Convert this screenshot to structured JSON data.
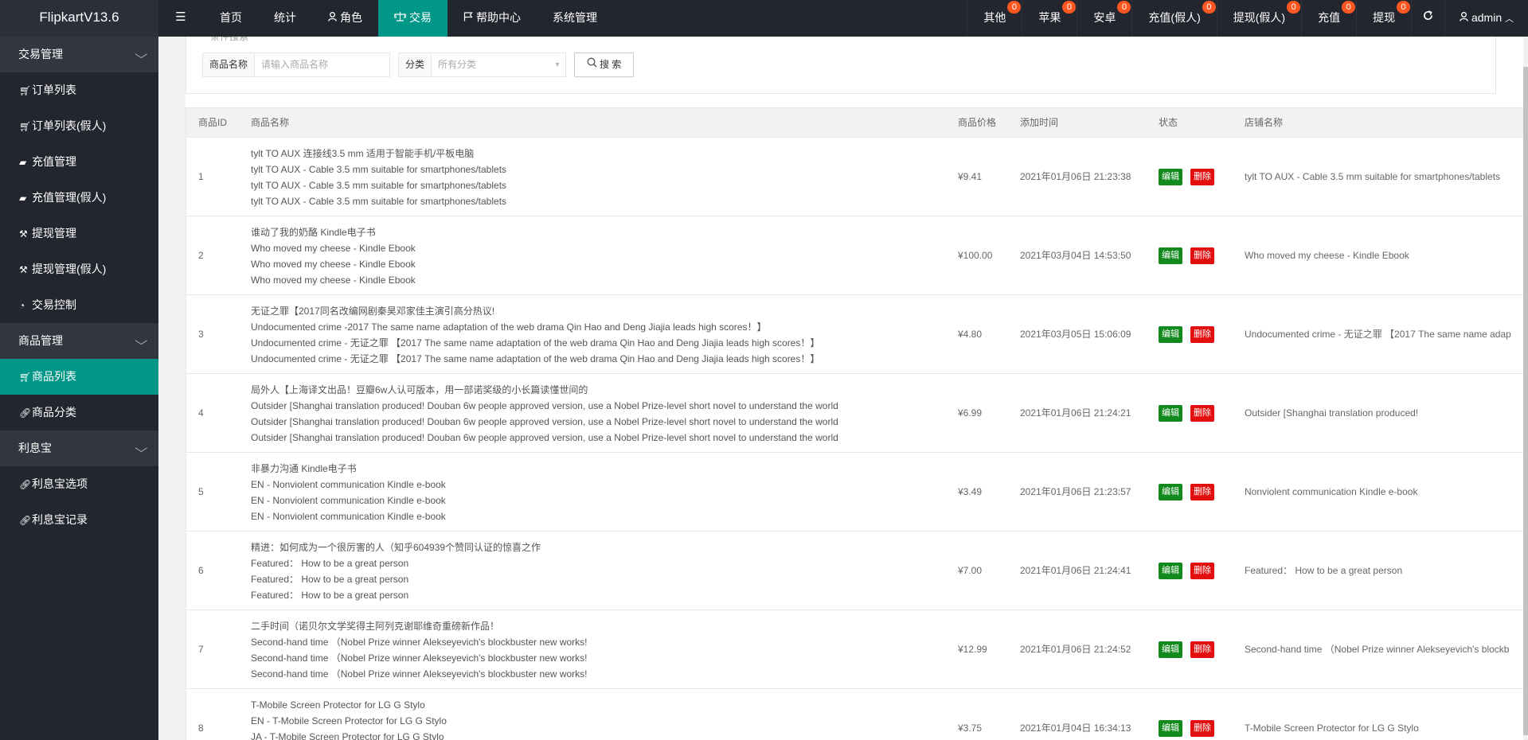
{
  "app": {
    "title": "FlipkartV13.6"
  },
  "topnav": {
    "toggle_icon": "☰",
    "items": [
      {
        "label": "首页",
        "icon": ""
      },
      {
        "label": "统计",
        "icon": ""
      },
      {
        "label": "角色",
        "icon": "user-icon"
      },
      {
        "label": "交易",
        "icon": "scale-icon",
        "active": true
      },
      {
        "label": "帮助中心",
        "icon": "flag-icon"
      },
      {
        "label": "系统管理",
        "icon": ""
      }
    ],
    "right_items": [
      {
        "label": "其他",
        "badge": "0"
      },
      {
        "label": "苹果",
        "badge": "0"
      },
      {
        "label": "安卓",
        "badge": "0"
      },
      {
        "label": "充值(假人)",
        "badge": "0"
      },
      {
        "label": "提现(假人)",
        "badge": "0"
      },
      {
        "label": "充值",
        "badge": "0"
      },
      {
        "label": "提现",
        "badge": "0"
      }
    ],
    "refresh_icon": "refresh-icon",
    "user": {
      "name": "admin"
    }
  },
  "sidebar": {
    "groups": [
      {
        "label": "交易管理",
        "items": [
          {
            "label": "订单列表",
            "icon": "cart-icon"
          },
          {
            "label": "订单列表(假人)",
            "icon": "cart-icon"
          },
          {
            "label": "充值管理",
            "icon": "chat-icon"
          },
          {
            "label": "充值管理(假人)",
            "icon": "chat-icon"
          },
          {
            "label": "提现管理",
            "icon": "gavel-icon"
          },
          {
            "label": "提现管理(假人)",
            "icon": "gavel-icon"
          },
          {
            "label": "交易控制",
            "icon": "dashboard-icon"
          }
        ]
      },
      {
        "label": "商品管理",
        "items": [
          {
            "label": "商品列表",
            "icon": "cart-icon",
            "active": true
          },
          {
            "label": "商品分类",
            "icon": "link-icon"
          }
        ]
      },
      {
        "label": "利息宝",
        "items": [
          {
            "label": "利息宝选项",
            "icon": "link-icon"
          },
          {
            "label": "利息宝记录",
            "icon": "link-icon"
          }
        ]
      }
    ]
  },
  "search": {
    "legend": "条件搜索",
    "name_label": "商品名称",
    "name_placeholder": "请输入商品名称",
    "category_label": "分类",
    "category_value": "所有分类",
    "button_label": "搜 索"
  },
  "table": {
    "headers": {
      "id": "商品ID",
      "name": "商品名称",
      "price": "商品价格",
      "time": "添加时间",
      "status": "状态",
      "shop": "店铺名称"
    },
    "edit_label": "编辑",
    "delete_label": "删除",
    "rows": [
      {
        "id": "1",
        "names": [
          "tylt TO AUX 连接线3.5 mm 适用于智能手机/平板电脑",
          "tylt TO AUX - Cable 3.5 mm suitable for smartphones/tablets",
          "tylt TO AUX - Cable 3.5 mm suitable for smartphones/tablets",
          "tylt TO AUX - Cable 3.5 mm suitable for smartphones/tablets"
        ],
        "price": "¥9.41",
        "time": "2021年01月06日 21:23:38",
        "shop": "tylt TO AUX - Cable 3.5 mm suitable for smartphones/tablets"
      },
      {
        "id": "2",
        "names": [
          "谁动了我的奶酪 Kindle电子书",
          "Who moved my cheese - Kindle Ebook",
          "Who moved my cheese - Kindle Ebook",
          "Who moved my cheese - Kindle Ebook"
        ],
        "price": "¥100.00",
        "time": "2021年03月04日 14:53:50",
        "shop": "Who moved my cheese - Kindle Ebook"
      },
      {
        "id": "3",
        "names": [
          "无证之罪【2017同名改编网剧秦昊邓家佳主演引高分热议!",
          "Undocumented crime -2017 The same name adaptation of the web drama Qin Hao and Deng Jiajia leads high scores！】",
          "Undocumented crime - 无证之罪 【2017 The same name adaptation of the web drama Qin Hao and Deng Jiajia leads high scores！】",
          "Undocumented crime - 无证之罪 【2017 The same name adaptation of the web drama Qin Hao and Deng Jiajia leads high scores！】"
        ],
        "price": "¥4.80",
        "time": "2021年03月05日 15:06:09",
        "shop": "Undocumented crime - 无证之罪 【2017 The same name adap"
      },
      {
        "id": "4",
        "names": [
          "局外人【上海译文出品！豆瓣6w人认可版本，用一部诺奖级的小长篇读懂世间的",
          "Outsider [Shanghai translation produced! Douban 6w people approved version, use a Nobel Prize-level short novel to understand the world",
          "Outsider [Shanghai translation produced! Douban 6w people approved version, use a Nobel Prize-level short novel to understand the world",
          "Outsider [Shanghai translation produced! Douban 6w people approved version, use a Nobel Prize-level short novel to understand the world"
        ],
        "price": "¥6.99",
        "time": "2021年01月06日 21:24:21",
        "shop": "Outsider [Shanghai translation produced!"
      },
      {
        "id": "5",
        "names": [
          "非暴力沟通 Kindle电子书",
          "EN - Nonviolent communication Kindle e-book",
          "EN - Nonviolent communication Kindle e-book",
          "EN - Nonviolent communication Kindle e-book"
        ],
        "price": "¥3.49",
        "time": "2021年01月06日 21:23:57",
        "shop": "Nonviolent communication Kindle e-book"
      },
      {
        "id": "6",
        "names": [
          "精进：如何成为一个很厉害的人（知乎604939个赞同认证的惊喜之作",
          "Featured： How to be a great person",
          "Featured： How to be a great person",
          "Featured： How to be a great person"
        ],
        "price": "¥7.00",
        "time": "2021年01月06日 21:24:41",
        "shop": "Featured： How to be a great person"
      },
      {
        "id": "7",
        "names": [
          "二手时间（诺贝尔文学奖得主阿列克谢耶维奇重磅新作品！",
          "Second-hand time （Nobel Prize winner Alekseyevich's blockbuster new works!",
          "Second-hand time （Nobel Prize winner Alekseyevich's blockbuster new works!",
          "Second-hand time （Nobel Prize winner Alekseyevich's blockbuster new works!"
        ],
        "price": "¥12.99",
        "time": "2021年01月06日 21:24:52",
        "shop": "Second-hand time （Nobel Prize winner Alekseyevich's blockb"
      },
      {
        "id": "8",
        "names": [
          "T-Mobile Screen Protector for LG G Stylo",
          "EN - T-Mobile Screen Protector for LG G Stylo",
          "JA - T-Mobile Screen Protector for LG G Stylo",
          ""
        ],
        "price": "¥3.75",
        "time": "2021年01月04日 16:34:13",
        "shop": "T-Mobile Screen Protector for LG G Stylo"
      }
    ]
  },
  "colors": {
    "accent": "#009688",
    "topbar": "#23262e",
    "badge": "#ff5722",
    "edit": "#138a1d",
    "delete": "#e30e0e"
  }
}
